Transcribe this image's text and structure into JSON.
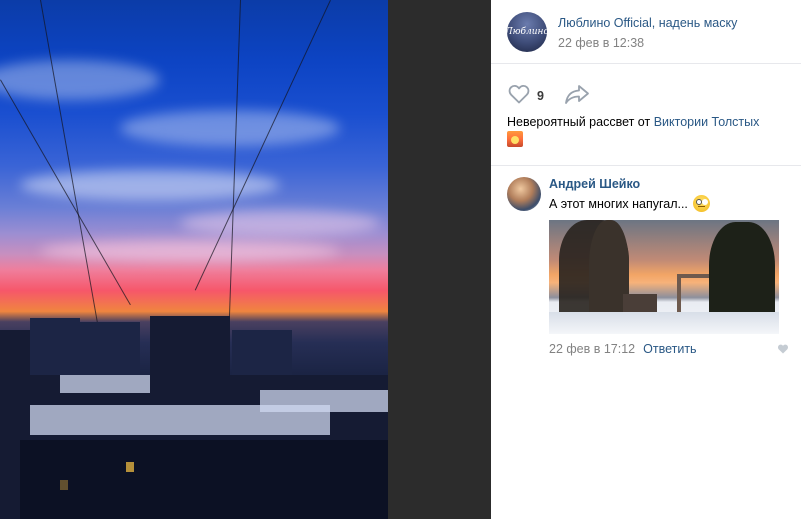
{
  "post": {
    "group_name": "Люблино Official, надень маску",
    "group_avatar_text": "Люблино",
    "date": "22 фев в 12:38",
    "likes_count": "9",
    "caption_text": "Невероятный рассвет от ",
    "caption_link": "Виктории Толстых",
    "icons": {
      "like": "heart-icon",
      "share": "share-arrow-icon",
      "emoji": "sunrise-emoji-icon"
    }
  },
  "comment": {
    "author": "Андрей Шейко",
    "text": "А этот многих напугал...",
    "date": "22 фев в 17:12",
    "reply_label": "Ответить",
    "icons": {
      "emoji": "rolling-eyes-emoji-icon",
      "like": "heart-icon"
    }
  },
  "colors": {
    "link": "#2a5885",
    "muted": "#828282",
    "divider": "#e7e8ec"
  }
}
